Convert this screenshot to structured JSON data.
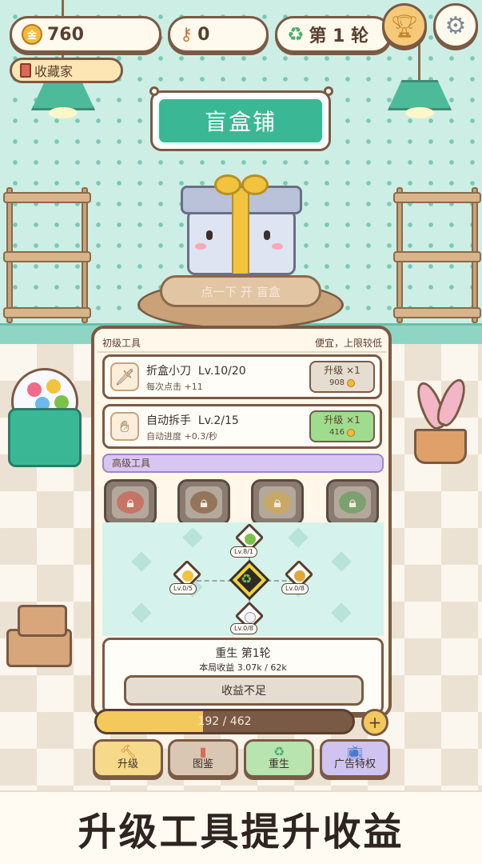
{
  "hud": {
    "coins": "760",
    "keys": "0",
    "round": "第 1 轮",
    "title_badge": "收藏家"
  },
  "shop": {
    "sign": "盲盒铺",
    "pedestal_text": "点一下 开 盲盒"
  },
  "basic_tools": {
    "header": "初级工具",
    "note": "便宜，上限较低",
    "items": [
      {
        "name": "折盒小刀",
        "level": "Lv.10/20",
        "desc": "每次点击 +11",
        "upgrade_label": "升级 ×1",
        "cost": "908",
        "icon": "knife-icon"
      },
      {
        "name": "自动拆手",
        "level": "Lv.2/15",
        "desc": "自动进度 +0.3/秒",
        "upgrade_label": "升级 ×1",
        "cost": "416",
        "icon": "hand-icon"
      }
    ]
  },
  "advanced_tools": {
    "header": "高级工具",
    "slots": [
      {
        "icon": "locked-red-icon",
        "tint": "#d24a3a"
      },
      {
        "icon": "locked-chest-icon",
        "tint": "#7a4a26"
      },
      {
        "icon": "locked-gold-icon",
        "tint": "#d8a73a"
      },
      {
        "icon": "locked-clover-icon",
        "tint": "#4c9a4a"
      }
    ]
  },
  "skill_tree": {
    "nodes": [
      {
        "id": "top",
        "label": "Lv.8/1",
        "icon": "green-orb-icon",
        "color": "#7cc24a"
      },
      {
        "id": "left",
        "label": "Lv.0/5",
        "icon": "hand-gold-icon",
        "color": "#f1c33e"
      },
      {
        "id": "right",
        "label": "Lv.0/8",
        "icon": "money-bag-icon",
        "color": "#e0a83a"
      },
      {
        "id": "bottom",
        "label": "Lv.0/8",
        "icon": "dice-icon",
        "color": "#f3f3f3"
      }
    ],
    "center_icon": "recycle-icon"
  },
  "rebirth": {
    "title": "重生 第1轮",
    "income": "本局收益 3.07k / 62k",
    "button": "收益不足"
  },
  "progress": {
    "text": "192 / 462",
    "current": 192,
    "max": 462
  },
  "nav": [
    {
      "label": "升级",
      "icon": "hammer-icon",
      "color": "#f6d98a"
    },
    {
      "label": "图鉴",
      "icon": "book-icon",
      "color": "#d9c7b4"
    },
    {
      "label": "重生",
      "icon": "recycle-icon",
      "color": "#b8e4b0"
    },
    {
      "label": "广告特权",
      "icon": "tv-icon",
      "color": "#cfc3ef"
    }
  ],
  "caption": "升级工具提升收益"
}
